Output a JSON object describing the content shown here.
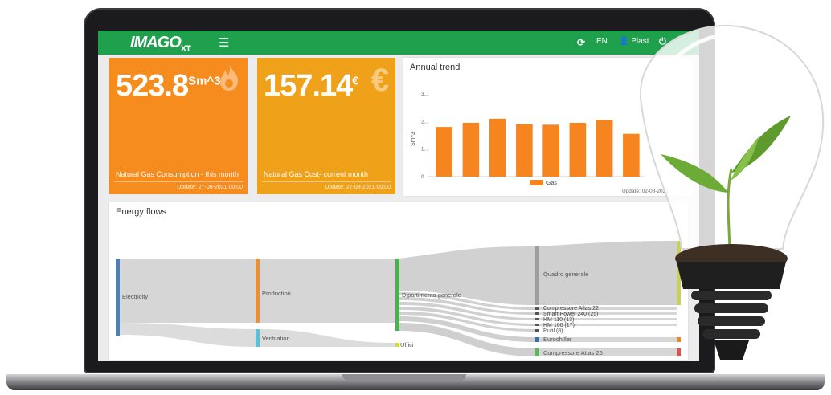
{
  "app": {
    "logo_main": "IMAGO",
    "logo_sub": "XT",
    "menu_icon": "hamburger-icon",
    "refresh_icon": "refresh-icon",
    "language": "EN",
    "user_icon": "user-icon",
    "user": "Plast",
    "power_icon": "power-icon"
  },
  "colors": {
    "header": "#1fa04d",
    "gas_card": "#f78c1e",
    "cost_card": "#f0a11a",
    "bar": "#f7851f"
  },
  "cards": [
    {
      "value": "523.8",
      "unit": "Sm^3",
      "icon": "flame-icon",
      "label": "Natural Gas Consumption - this month",
      "update": "Update: 27-08-2021 00:00"
    },
    {
      "value": "157.14",
      "unit": "€",
      "icon": "euro-icon",
      "icon_glyph": "€",
      "label": "Natural Gas Cost- current month",
      "update": "Update: 27-08-2021 00:00"
    }
  ],
  "annual_trend": {
    "title": "Annual trend",
    "update": "Update: 02-08-2021"
  },
  "chart_data": {
    "type": "bar",
    "title": "Annual trend",
    "ylabel": "Sm^3",
    "yticks": [
      "0",
      "1...",
      "2...",
      "3..."
    ],
    "ylim": [
      0,
      3.2
    ],
    "series": [
      {
        "name": "Gas",
        "values": [
          1.8,
          1.95,
          2.1,
          1.9,
          1.88,
          1.95,
          2.05,
          1.55
        ]
      }
    ],
    "legend": "bottom-center",
    "grid": false
  },
  "energy_flows": {
    "title": "Energy flows",
    "nodes": {
      "electricity": "Electricity",
      "production": "Production",
      "ventilation": "Ventilation",
      "dipartimento": "Dipartimento generale",
      "uffici": "Uffici",
      "quadro": "Quadro generale",
      "compressore22": "Compressore Atlas 22",
      "smartpower": "Smart Power 240 (25)",
      "hm110": "HM 110 (13)",
      "hm100": "HM 100 (17)",
      "rutil": "Rutil (8)",
      "eurochiller": "Eurochiller",
      "compressore26": "Compressore Atlas 26"
    }
  }
}
